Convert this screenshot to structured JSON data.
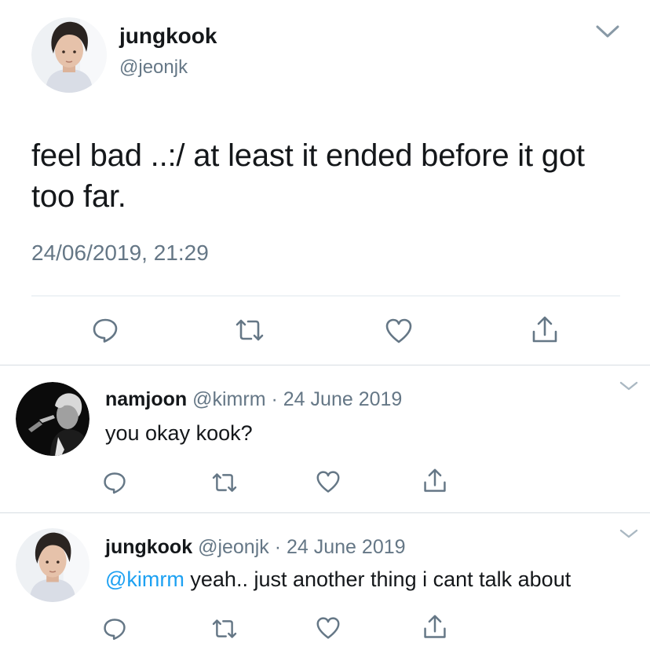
{
  "main_tweet": {
    "display_name": "jungkook",
    "handle": "@jeonjk",
    "text": "feel bad ..:/ at least it ended before it got too far.",
    "timestamp": "24/06/2019, 21:29",
    "avatar_icon": "profile-photo",
    "actions": [
      "reply-icon",
      "retweet-icon",
      "like-icon",
      "share-icon"
    ]
  },
  "replies": [
    {
      "display_name": "namjoon",
      "handle": "@kimrm",
      "separator": "·",
      "date": "24 June 2019",
      "text": "you okay kook?",
      "avatar_icon": "profile-photo-dark"
    },
    {
      "display_name": "jungkook",
      "handle": "@jeonjk",
      "separator": "·",
      "date": "24 June 2019",
      "mention": "@kimrm",
      "text": " yeah.. just another thing i cant talk about",
      "avatar_icon": "profile-photo"
    }
  ],
  "colors": {
    "text": "#14171a",
    "secondary": "#657786",
    "mention": "#1da1f2",
    "divider": "#e1e8ed"
  }
}
